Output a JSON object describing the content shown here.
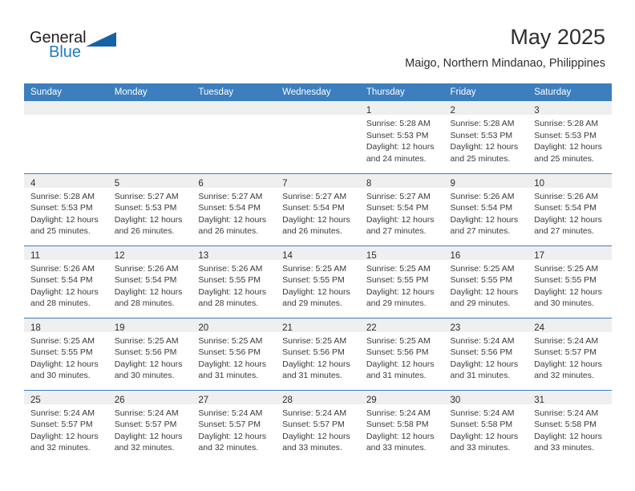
{
  "brand": {
    "name_part1": "General",
    "name_part2": "Blue",
    "triangle_icon": "blue-triangle-icon",
    "accent_color": "#1464a5",
    "blue_text_color": "#1f7cc1"
  },
  "header": {
    "title": "May 2025",
    "subtitle": "Maigo, Northern Mindanao, Philippines"
  },
  "calendar": {
    "header_bg_color": "#3c7ebe",
    "daynum_band_color": "#efefef",
    "weekday_headers": [
      "Sunday",
      "Monday",
      "Tuesday",
      "Wednesday",
      "Thursday",
      "Friday",
      "Saturday"
    ],
    "weeks": [
      [
        {
          "day": "",
          "empty": true,
          "lines": []
        },
        {
          "day": "",
          "empty": true,
          "lines": []
        },
        {
          "day": "",
          "empty": true,
          "lines": []
        },
        {
          "day": "",
          "empty": true,
          "lines": []
        },
        {
          "day": "1",
          "empty": false,
          "lines": [
            "Sunrise: 5:28 AM",
            "Sunset: 5:53 PM",
            "Daylight: 12 hours",
            "and 24 minutes."
          ]
        },
        {
          "day": "2",
          "empty": false,
          "lines": [
            "Sunrise: 5:28 AM",
            "Sunset: 5:53 PM",
            "Daylight: 12 hours",
            "and 25 minutes."
          ]
        },
        {
          "day": "3",
          "empty": false,
          "lines": [
            "Sunrise: 5:28 AM",
            "Sunset: 5:53 PM",
            "Daylight: 12 hours",
            "and 25 minutes."
          ]
        }
      ],
      [
        {
          "day": "4",
          "empty": false,
          "lines": [
            "Sunrise: 5:28 AM",
            "Sunset: 5:53 PM",
            "Daylight: 12 hours",
            "and 25 minutes."
          ]
        },
        {
          "day": "5",
          "empty": false,
          "lines": [
            "Sunrise: 5:27 AM",
            "Sunset: 5:53 PM",
            "Daylight: 12 hours",
            "and 26 minutes."
          ]
        },
        {
          "day": "6",
          "empty": false,
          "lines": [
            "Sunrise: 5:27 AM",
            "Sunset: 5:54 PM",
            "Daylight: 12 hours",
            "and 26 minutes."
          ]
        },
        {
          "day": "7",
          "empty": false,
          "lines": [
            "Sunrise: 5:27 AM",
            "Sunset: 5:54 PM",
            "Daylight: 12 hours",
            "and 26 minutes."
          ]
        },
        {
          "day": "8",
          "empty": false,
          "lines": [
            "Sunrise: 5:27 AM",
            "Sunset: 5:54 PM",
            "Daylight: 12 hours",
            "and 27 minutes."
          ]
        },
        {
          "day": "9",
          "empty": false,
          "lines": [
            "Sunrise: 5:26 AM",
            "Sunset: 5:54 PM",
            "Daylight: 12 hours",
            "and 27 minutes."
          ]
        },
        {
          "day": "10",
          "empty": false,
          "lines": [
            "Sunrise: 5:26 AM",
            "Sunset: 5:54 PM",
            "Daylight: 12 hours",
            "and 27 minutes."
          ]
        }
      ],
      [
        {
          "day": "11",
          "empty": false,
          "lines": [
            "Sunrise: 5:26 AM",
            "Sunset: 5:54 PM",
            "Daylight: 12 hours",
            "and 28 minutes."
          ]
        },
        {
          "day": "12",
          "empty": false,
          "lines": [
            "Sunrise: 5:26 AM",
            "Sunset: 5:54 PM",
            "Daylight: 12 hours",
            "and 28 minutes."
          ]
        },
        {
          "day": "13",
          "empty": false,
          "lines": [
            "Sunrise: 5:26 AM",
            "Sunset: 5:55 PM",
            "Daylight: 12 hours",
            "and 28 minutes."
          ]
        },
        {
          "day": "14",
          "empty": false,
          "lines": [
            "Sunrise: 5:25 AM",
            "Sunset: 5:55 PM",
            "Daylight: 12 hours",
            "and 29 minutes."
          ]
        },
        {
          "day": "15",
          "empty": false,
          "lines": [
            "Sunrise: 5:25 AM",
            "Sunset: 5:55 PM",
            "Daylight: 12 hours",
            "and 29 minutes."
          ]
        },
        {
          "day": "16",
          "empty": false,
          "lines": [
            "Sunrise: 5:25 AM",
            "Sunset: 5:55 PM",
            "Daylight: 12 hours",
            "and 29 minutes."
          ]
        },
        {
          "day": "17",
          "empty": false,
          "lines": [
            "Sunrise: 5:25 AM",
            "Sunset: 5:55 PM",
            "Daylight: 12 hours",
            "and 30 minutes."
          ]
        }
      ],
      [
        {
          "day": "18",
          "empty": false,
          "lines": [
            "Sunrise: 5:25 AM",
            "Sunset: 5:55 PM",
            "Daylight: 12 hours",
            "and 30 minutes."
          ]
        },
        {
          "day": "19",
          "empty": false,
          "lines": [
            "Sunrise: 5:25 AM",
            "Sunset: 5:56 PM",
            "Daylight: 12 hours",
            "and 30 minutes."
          ]
        },
        {
          "day": "20",
          "empty": false,
          "lines": [
            "Sunrise: 5:25 AM",
            "Sunset: 5:56 PM",
            "Daylight: 12 hours",
            "and 31 minutes."
          ]
        },
        {
          "day": "21",
          "empty": false,
          "lines": [
            "Sunrise: 5:25 AM",
            "Sunset: 5:56 PM",
            "Daylight: 12 hours",
            "and 31 minutes."
          ]
        },
        {
          "day": "22",
          "empty": false,
          "lines": [
            "Sunrise: 5:25 AM",
            "Sunset: 5:56 PM",
            "Daylight: 12 hours",
            "and 31 minutes."
          ]
        },
        {
          "day": "23",
          "empty": false,
          "lines": [
            "Sunrise: 5:24 AM",
            "Sunset: 5:56 PM",
            "Daylight: 12 hours",
            "and 31 minutes."
          ]
        },
        {
          "day": "24",
          "empty": false,
          "lines": [
            "Sunrise: 5:24 AM",
            "Sunset: 5:57 PM",
            "Daylight: 12 hours",
            "and 32 minutes."
          ]
        }
      ],
      [
        {
          "day": "25",
          "empty": false,
          "lines": [
            "Sunrise: 5:24 AM",
            "Sunset: 5:57 PM",
            "Daylight: 12 hours",
            "and 32 minutes."
          ]
        },
        {
          "day": "26",
          "empty": false,
          "lines": [
            "Sunrise: 5:24 AM",
            "Sunset: 5:57 PM",
            "Daylight: 12 hours",
            "and 32 minutes."
          ]
        },
        {
          "day": "27",
          "empty": false,
          "lines": [
            "Sunrise: 5:24 AM",
            "Sunset: 5:57 PM",
            "Daylight: 12 hours",
            "and 32 minutes."
          ]
        },
        {
          "day": "28",
          "empty": false,
          "lines": [
            "Sunrise: 5:24 AM",
            "Sunset: 5:57 PM",
            "Daylight: 12 hours",
            "and 33 minutes."
          ]
        },
        {
          "day": "29",
          "empty": false,
          "lines": [
            "Sunrise: 5:24 AM",
            "Sunset: 5:58 PM",
            "Daylight: 12 hours",
            "and 33 minutes."
          ]
        },
        {
          "day": "30",
          "empty": false,
          "lines": [
            "Sunrise: 5:24 AM",
            "Sunset: 5:58 PM",
            "Daylight: 12 hours",
            "and 33 minutes."
          ]
        },
        {
          "day": "31",
          "empty": false,
          "lines": [
            "Sunrise: 5:24 AM",
            "Sunset: 5:58 PM",
            "Daylight: 12 hours",
            "and 33 minutes."
          ]
        }
      ]
    ]
  }
}
